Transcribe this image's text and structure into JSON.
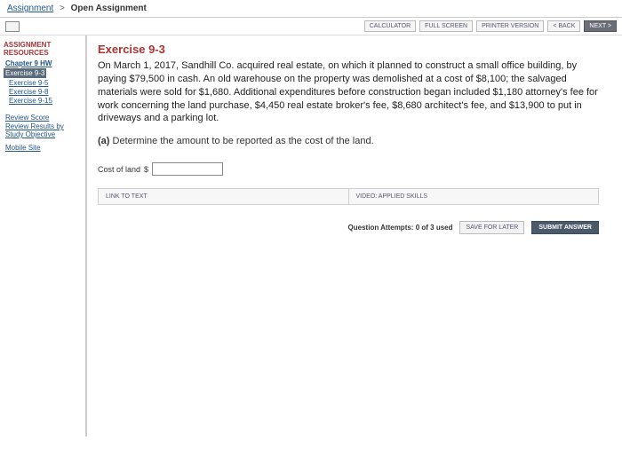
{
  "breadcrumb": {
    "root": "Assignment",
    "current": "Open Assignment"
  },
  "tools": {
    "calculator": "CALCULATOR",
    "fullscreen": "FULL SCREEN",
    "printer": "PRINTER VERSION",
    "back": "< BACK",
    "next": "NEXT >"
  },
  "sidebar": {
    "heading": "ASSIGNMENT RESOURCES",
    "chapter": "Chapter 9 HW",
    "items": [
      "Exercise 9-3",
      "Exercise 9-5",
      "Exercise 9-8",
      "Exercise 9-15"
    ],
    "review_score": "Review Score",
    "review_results": "Review Results by Study Objective",
    "mobile": "Mobile Site"
  },
  "exercise": {
    "title": "Exercise 9-3",
    "body": "On March 1, 2017, Sandhill Co. acquired real estate, on which it planned to construct a small office building, by paying $79,500 in cash. An old warehouse on the property was demolished at a cost of $8,100; the salvaged materials were sold for $1,680. Additional expenditures before construction began included $1,180 attorney's fee for work concerning the land purchase, $4,450 real estate broker's fee, $8,680 architect's fee, and $13,900 to put in driveways and a parking lot.",
    "part_label": "(a)",
    "part_text": "Determine the amount to be reported as the cost of the land.",
    "input_label": "Cost of land",
    "currency": "$",
    "input_value": ""
  },
  "help": {
    "link_text": "LINK TO TEXT",
    "video": "VIDEO: APPLIED SKILLS"
  },
  "footer": {
    "attempts": "Question Attempts: 0 of 3 used",
    "save": "SAVE FOR LATER",
    "submit": "SUBMIT ANSWER"
  }
}
